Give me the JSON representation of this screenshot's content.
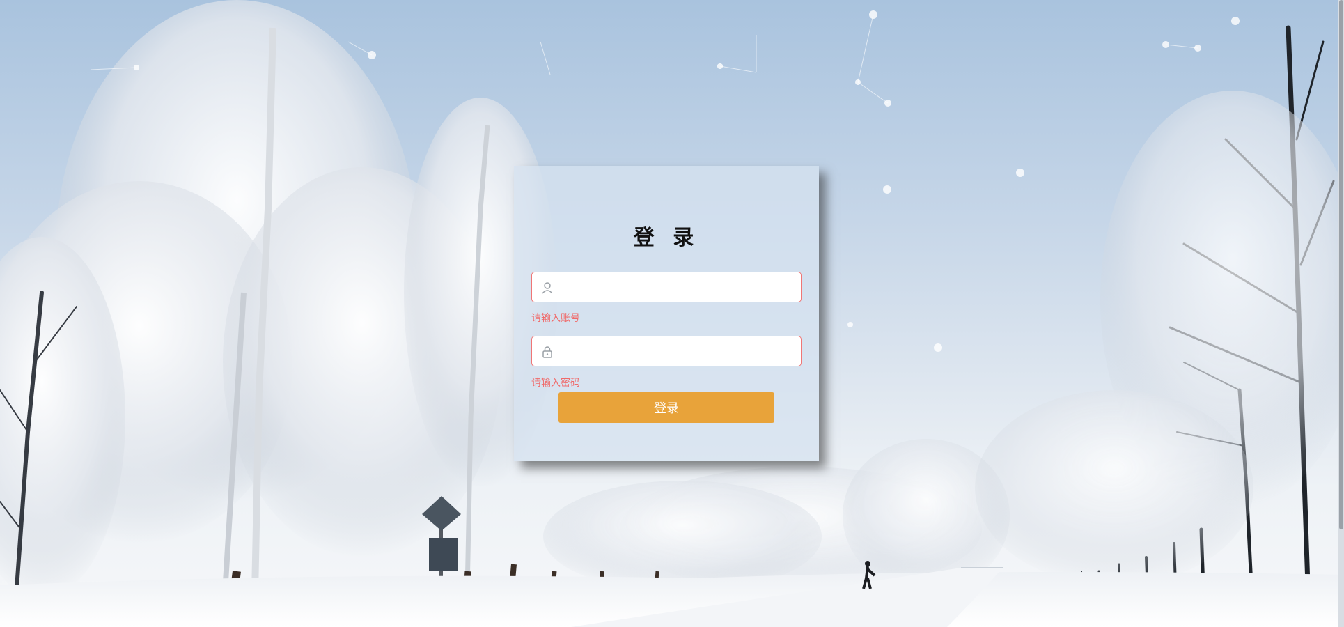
{
  "login": {
    "title": "登 录",
    "username": {
      "value": "",
      "placeholder": "",
      "error": "请输入账号"
    },
    "password": {
      "value": "",
      "placeholder": "",
      "error": "请输入密码"
    },
    "submit_label": "登录"
  },
  "icons": {
    "username": "user-icon",
    "password": "lock-icon"
  },
  "colors": {
    "button": "#e8a33a",
    "error": "#f06a6a",
    "field_border": "#f07676"
  }
}
